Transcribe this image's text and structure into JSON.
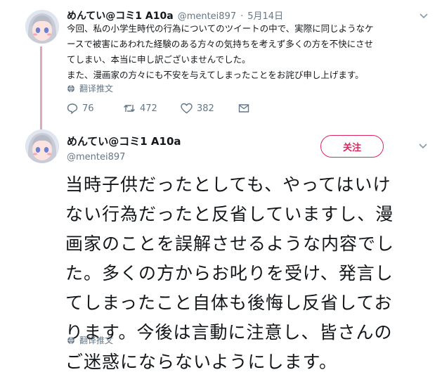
{
  "tweet1": {
    "display_name": "めんてい@コミ1 A10a",
    "handle": "@mentei897",
    "separator": "·",
    "date": "5月14日",
    "text_lines": [
      "今回、私の小学生時代の行為についてのツイートの中で、実際に同じようなケ",
      "ースで被害にあわれた経験のある方々の気持ちを考えず多くの方を不快にさせ",
      "てしまい、本当に申し訳ございませんでした。",
      "また、漫画家の方々にも不安を与えてしまったことをお詫び申し上げます。"
    ],
    "translate_label": "翻译推文",
    "reply_count": "76",
    "retweet_count": "472",
    "like_count": "382"
  },
  "tweet2": {
    "display_name": "めんてい@コミ1 A10a",
    "handle": "@mentei897",
    "follow_label": "关注",
    "text_lines": [
      "当時子供だったとしても、やってはいけ",
      "ない行為だったと反省していますし、漫",
      "画家のことを誤解させるような内容でし",
      "た。多くの方からお叱りを受け、発言し",
      "てしまったこと自体も後悔し反省してお",
      "ります。今後は言動に注意し、皆さんの",
      "ご迷惑にならないようにします。"
    ],
    "translate_label": "翻译推文"
  },
  "colors": {
    "text": "#14171a",
    "muted": "#657786",
    "accent": "#e0245e",
    "thread_line": "#e0a8bb"
  },
  "icons": [
    "avatar-image",
    "reply-icon",
    "retweet-icon",
    "like-icon",
    "share-icon",
    "globe-icon",
    "chevron-down-icon"
  ]
}
